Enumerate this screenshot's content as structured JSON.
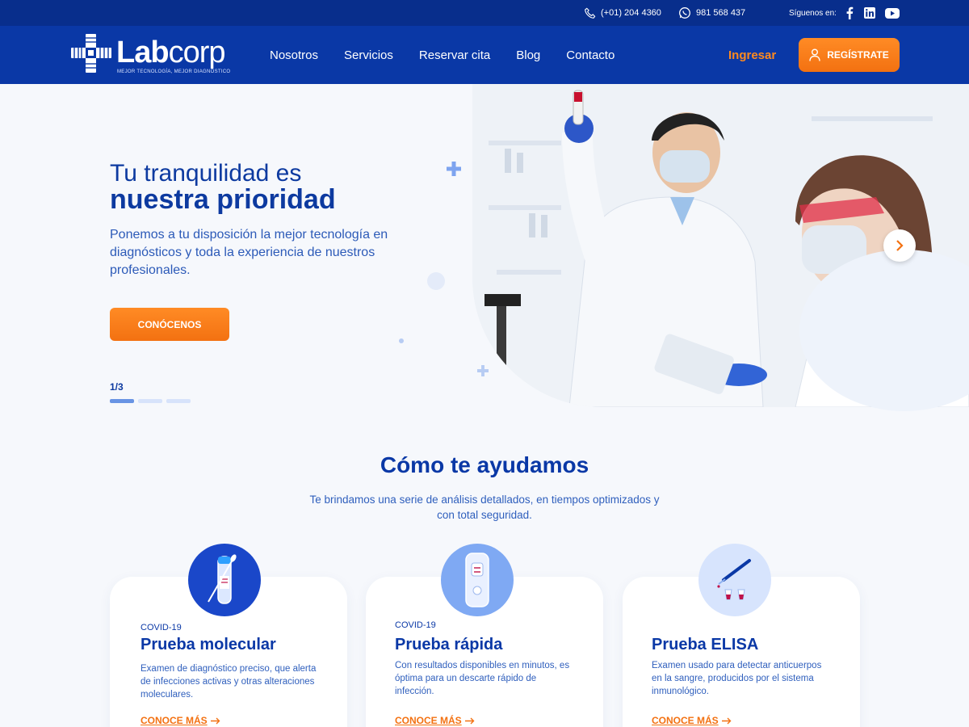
{
  "topbar": {
    "phone": "(+01) 204 4360",
    "whatsapp": "981 568 437",
    "follow_label": "Síguenos en:",
    "social": [
      "facebook-icon",
      "linkedin-icon",
      "youtube-icon"
    ]
  },
  "brand": {
    "name_bold": "Lab",
    "name_light": "corp",
    "tagline": "MEJOR TECNOLOGÍA, MEJOR DIAGNÓSTICO"
  },
  "nav": {
    "items": [
      "Nosotros",
      "Servicios",
      "Reservar cita",
      "Blog",
      "Contacto"
    ],
    "login": "Ingresar",
    "register": "REGÍSTRATE"
  },
  "hero": {
    "title_light": "Tu tranquilidad es",
    "title_bold": "nuestra prioridad",
    "description": "Ponemos a tu disposición la mejor tecnología en diagnósticos y toda la experiencia de nuestros profesionales.",
    "cta": "CONÓCENOS",
    "counter": "1/3",
    "current_slide": 1,
    "total_slides": 3
  },
  "services": {
    "title": "Cómo te ayudamos",
    "subtitle": "Te brindamos una serie de análisis detallados, en tiempos optimizados y con total seguridad.",
    "cards": [
      {
        "tag": "COVID-19",
        "title": "Prueba molecular",
        "description": "Examen de diagnóstico preciso, que alerta de infecciones activas y otras alteraciones moleculares.",
        "link": "CONOCE MÁS",
        "icon": "swab-tube-icon"
      },
      {
        "tag": "COVID-19",
        "title": "Prueba rápida",
        "description": "Con resultados disponibles en minutos, es óptima para un descarte rápido de infección.",
        "link": "CONOCE MÁS",
        "icon": "rapid-test-icon"
      },
      {
        "tag": "",
        "title": "Prueba ELISA",
        "description": "Examen usado para detectar anticuerpos en la sangre, producidos por el sistema inmunológico.",
        "link": "CONOCE MÁS",
        "icon": "pipette-icon"
      }
    ]
  },
  "colors": {
    "primary_blue": "#0a38a6",
    "topbar_blue": "#082e8c",
    "accent_orange": "#f37111",
    "background": "#f6f8fc"
  }
}
